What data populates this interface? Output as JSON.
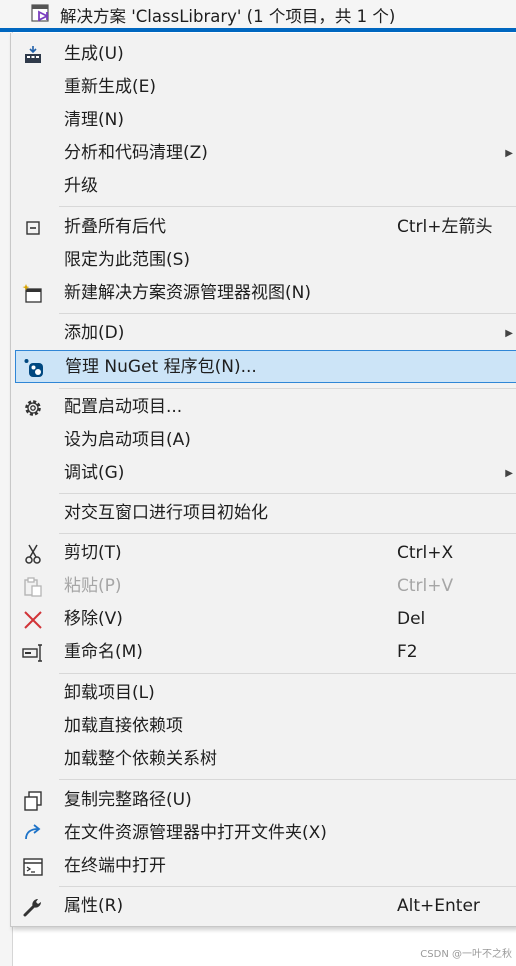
{
  "tree": {
    "title": "解决方案 'ClassLibrary' (1 个项目，共 1 个)",
    "icon": "visual-studio-solution-icon"
  },
  "menu": {
    "items": [
      {
        "label": "生成(U)",
        "shortcut": "",
        "icon": "build-icon"
      },
      {
        "label": "重新生成(E)",
        "shortcut": ""
      },
      {
        "label": "清理(N)",
        "shortcut": ""
      },
      {
        "label": "分析和代码清理(Z)",
        "shortcut": "",
        "submenu": true
      },
      {
        "label": "升级",
        "shortcut": ""
      },
      {
        "label": "折叠所有后代",
        "shortcut": "Ctrl+左箭头",
        "icon": "collapse-icon"
      },
      {
        "label": "限定为此范围(S)",
        "shortcut": ""
      },
      {
        "label": "新建解决方案资源管理器视图(N)",
        "shortcut": "",
        "icon": "new-view-icon"
      },
      {
        "label": "添加(D)",
        "shortcut": "",
        "submenu": true
      },
      {
        "label": "管理 NuGet 程序包(N)...",
        "shortcut": "",
        "icon": "nuget-icon",
        "highlighted": true
      },
      {
        "label": "配置启动项目...",
        "shortcut": "",
        "icon": "gear-icon"
      },
      {
        "label": "设为启动项目(A)",
        "shortcut": ""
      },
      {
        "label": "调试(G)",
        "shortcut": "",
        "submenu": true
      },
      {
        "label": "对交互窗口进行项目初始化",
        "shortcut": ""
      },
      {
        "label": "剪切(T)",
        "shortcut": "Ctrl+X",
        "icon": "scissors-icon"
      },
      {
        "label": "粘贴(P)",
        "shortcut": "Ctrl+V",
        "icon": "paste-icon",
        "disabled": true
      },
      {
        "label": "移除(V)",
        "shortcut": "Del",
        "icon": "remove-icon"
      },
      {
        "label": "重命名(M)",
        "shortcut": "F2",
        "icon": "rename-icon"
      },
      {
        "label": "卸载项目(L)",
        "shortcut": ""
      },
      {
        "label": "加载直接依赖项",
        "shortcut": ""
      },
      {
        "label": "加载整个依赖关系树",
        "shortcut": ""
      },
      {
        "label": "复制完整路径(U)",
        "shortcut": "",
        "icon": "copy-icon"
      },
      {
        "label": "在文件资源管理器中打开文件夹(X)",
        "shortcut": "",
        "icon": "open-folder-arrow-icon"
      },
      {
        "label": "在终端中打开",
        "shortcut": "",
        "icon": "terminal-icon"
      },
      {
        "label": "属性(R)",
        "shortcut": "Alt+Enter",
        "icon": "wrench-icon"
      }
    ]
  },
  "watermark": "CSDN @一叶不之秋"
}
